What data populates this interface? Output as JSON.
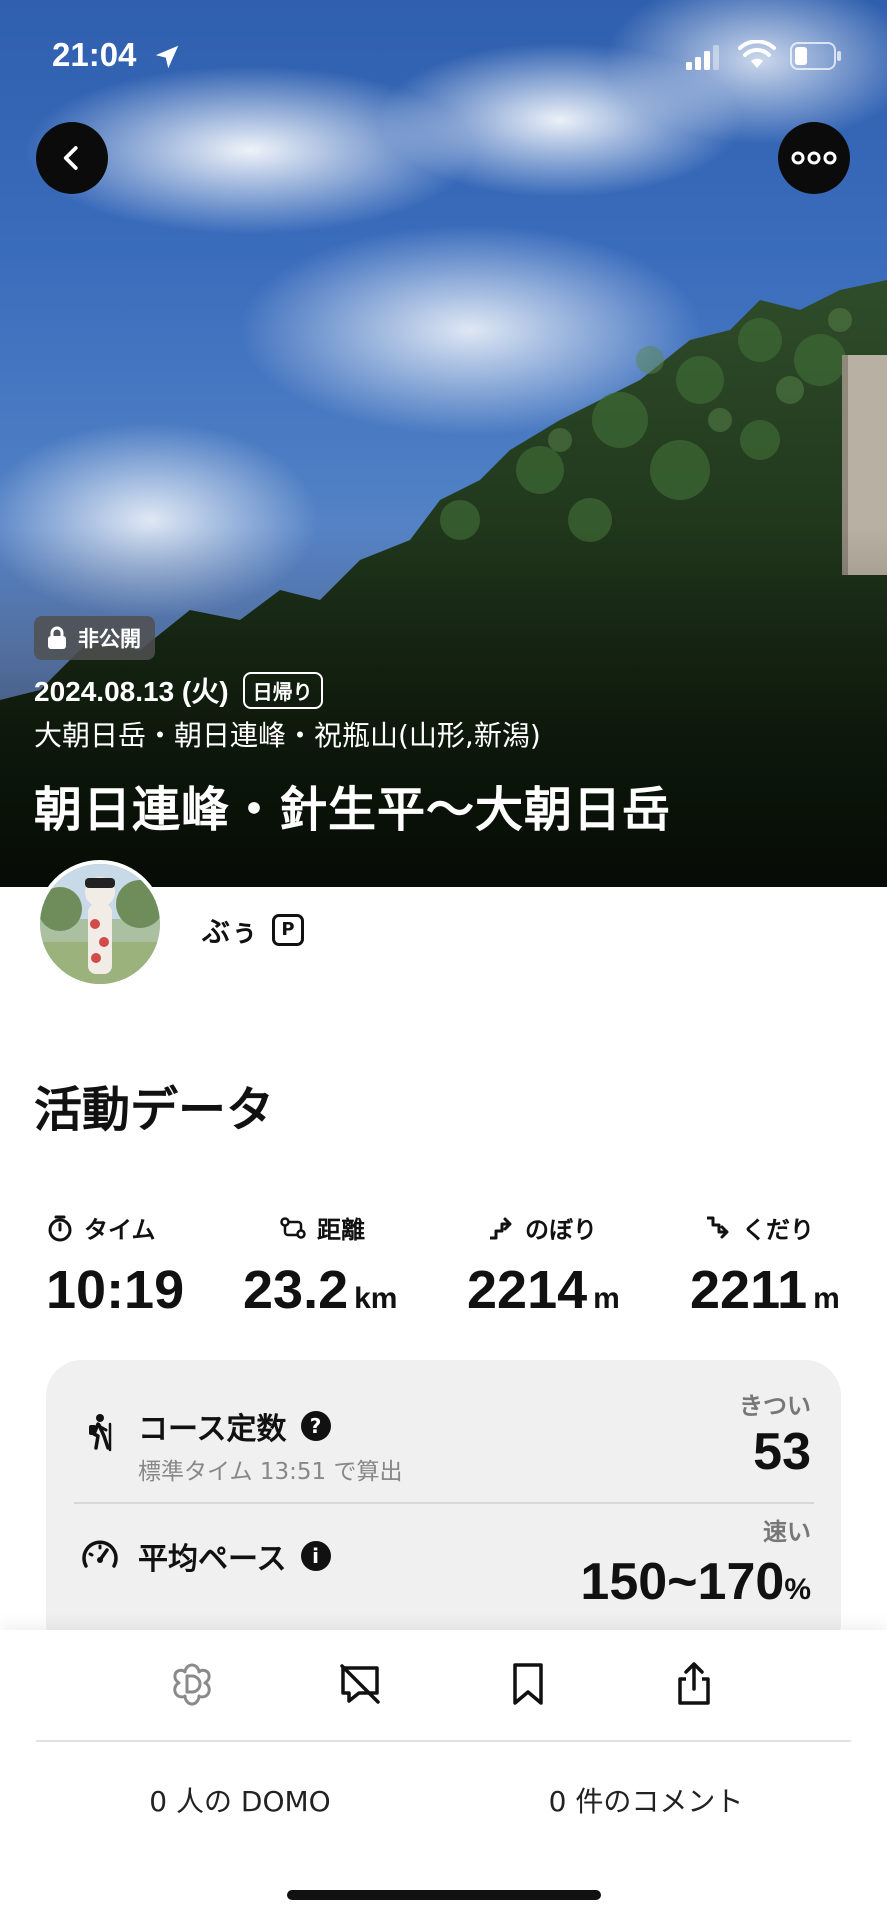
{
  "status_bar": {
    "time": "21:04"
  },
  "hero": {
    "private_label": "非公開",
    "date": "2024.08.13 (火)",
    "day_trip_label": "日帰り",
    "mountains": "大朝日岳・朝日連峰・祝瓶山(山形,新潟)",
    "title": "朝日連峰・針生平〜大朝日岳"
  },
  "user": {
    "name": "ぶぅ",
    "premium_badge": "P"
  },
  "activity": {
    "section_title": "活動データ",
    "stats": [
      {
        "label": "タイム",
        "value": "10:19",
        "unit": ""
      },
      {
        "label": "距離",
        "value": "23.2",
        "unit": "km"
      },
      {
        "label": "のぼり",
        "value": "2214",
        "unit": "m"
      },
      {
        "label": "くだり",
        "value": "2211",
        "unit": "m"
      }
    ],
    "course": {
      "title": "コース定数",
      "help": "?",
      "subtitle": "標準タイム 13:51 で算出",
      "level": "きつい",
      "value": "53"
    },
    "pace": {
      "title": "平均ペース",
      "info": "i",
      "level": "速い",
      "value": "150~170",
      "unit": "%"
    }
  },
  "actions": {
    "domo_count_label": "0 人の DOMO",
    "comment_count_label": "0 件のコメント"
  },
  "icons": {
    "back": "chevron-left-icon",
    "more": "ellipsis-icon",
    "lock": "lock-icon",
    "domo": "domo-flower-icon",
    "comment_off": "comment-off-icon",
    "bookmark": "bookmark-icon",
    "share": "share-icon"
  }
}
